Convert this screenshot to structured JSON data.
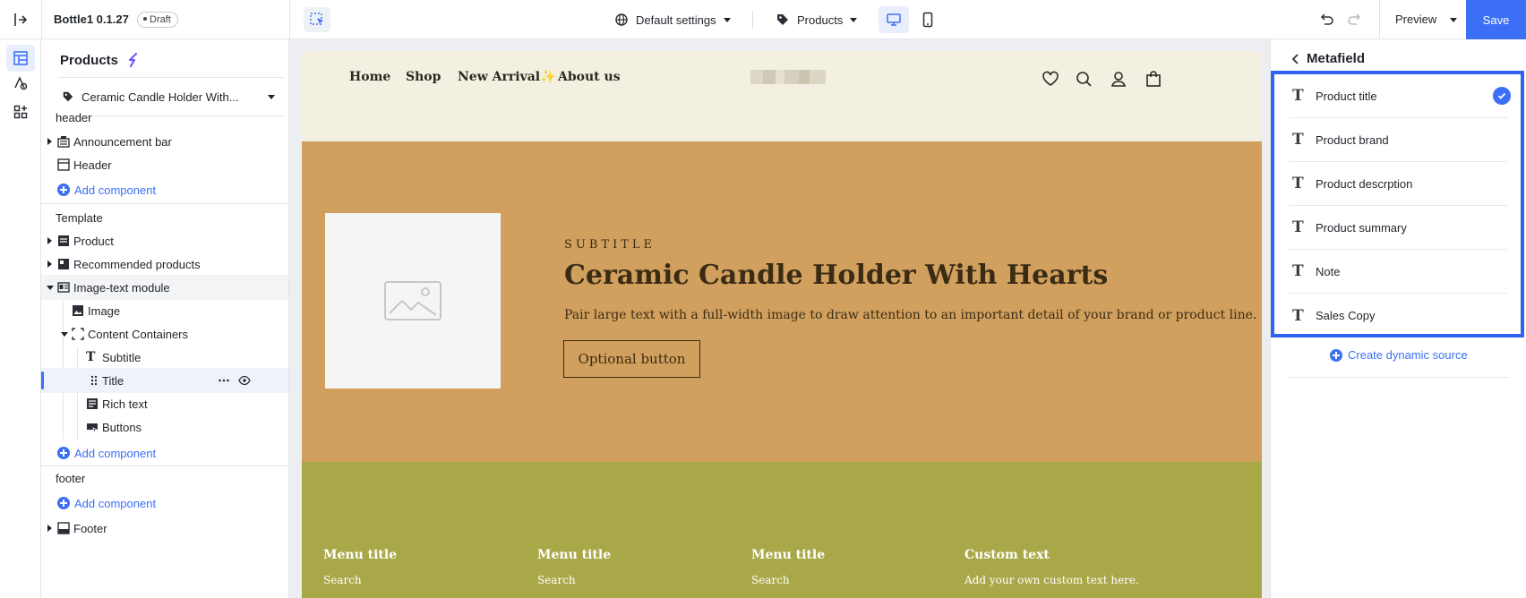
{
  "topbar": {
    "app_title": "Bottle1 0.1.27",
    "status_badge": "Draft",
    "settings_label": "Default settings",
    "page_type_label": "Products",
    "preview_label": "Preview",
    "save_label": "Save"
  },
  "layers": {
    "panel_title": "Products",
    "product_selector": "Ceramic Candle Holder With...",
    "header_section": "header",
    "header_items": [
      "Announcement bar",
      "Header"
    ],
    "add_component_label": "Add component",
    "template_section": "Template",
    "template_items": [
      "Product",
      "Recommended products",
      "Image-text module"
    ],
    "image_text_children": [
      "Image",
      "Content Containers"
    ],
    "content_children": [
      "Subtitle",
      "Title",
      "Rich text",
      "Buttons"
    ],
    "footer_section": "footer",
    "footer_items": [
      "Footer"
    ]
  },
  "preview": {
    "nav": [
      "Home",
      "Shop",
      "New Arrival",
      "About us"
    ],
    "nav_sparkle": "✨",
    "hero": {
      "subtitle": "SUBTITLE",
      "title": "Ceramic Candle Holder With Hearts",
      "body": "Pair large text with a full-width image to draw attention to an important detail of your brand or product line.",
      "button": "Optional button"
    },
    "footer": {
      "columns": [
        {
          "title": "Menu title",
          "item": "Search"
        },
        {
          "title": "Menu title",
          "item": "Search"
        },
        {
          "title": "Menu title",
          "item": "Search"
        },
        {
          "title": "Custom text",
          "item": "Add your own custom text here."
        }
      ]
    },
    "colors": {
      "header_bg": "#f3f0e2",
      "hero_bg": "#d1a05e",
      "footer_bg": "#a9a849"
    }
  },
  "metafield": {
    "title": "Metafield",
    "items": [
      {
        "label": "Product title",
        "selected": true
      },
      {
        "label": "Product brand",
        "selected": false
      },
      {
        "label": "Product descrption",
        "selected": false
      },
      {
        "label": "Product summary",
        "selected": false
      },
      {
        "label": "Note",
        "selected": false
      },
      {
        "label": "Sales Copy",
        "selected": false
      }
    ],
    "create_label": "Create dynamic source"
  },
  "accent_color": "#3b6ff5"
}
